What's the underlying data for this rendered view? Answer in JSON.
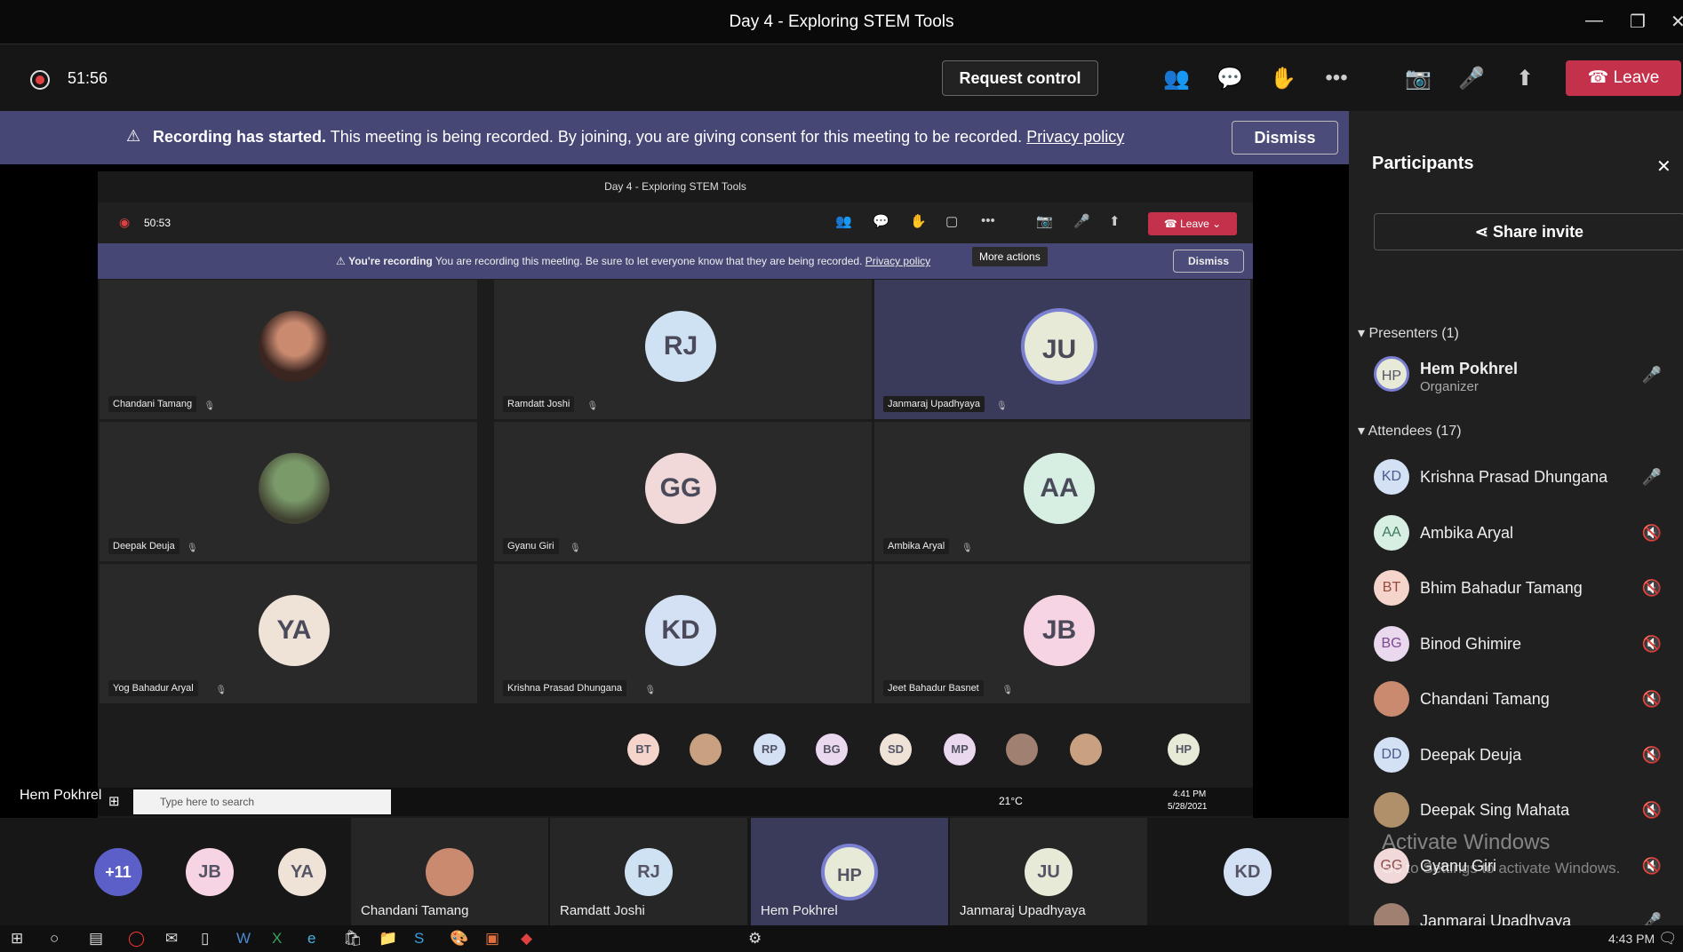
{
  "title": "Day 4 - Exploring STEM Tools",
  "timer": "51:56",
  "toolbar": {
    "request": "Request control",
    "leave": "Leave"
  },
  "banner": {
    "bold": "Recording has started.",
    "text": "This meeting is being recorded. By joining, you are giving consent for this meeting to be recorded.",
    "link": "Privacy policy",
    "dismiss": "Dismiss"
  },
  "inner": {
    "title": "Day 4 - Exploring STEM Tools",
    "timer": "50:53",
    "leave": "Leave",
    "tooltip": "More actions",
    "rec_bold": "You're recording",
    "rec_text": "You are recording this meeting. Be sure to let everyone know that they are being recorded.",
    "link": "Privacy policy",
    "dismiss": "Dismiss"
  },
  "tiles": [
    {
      "name": "Chandani Tamang",
      "initials": "",
      "bg": "#c98a70",
      "photo": true
    },
    {
      "name": "Ramdatt Joshi",
      "initials": "RJ",
      "bg": "#cfe2f3"
    },
    {
      "name": "Janmaraj Upadhyaya",
      "initials": "JU",
      "bg": "#e6ead6"
    },
    {
      "name": "Deepak Deuja",
      "initials": "",
      "bg": "#7a9a6a",
      "photo": true
    },
    {
      "name": "Gyanu Giri",
      "initials": "GG",
      "bg": "#f1d9d9"
    },
    {
      "name": "Ambika Aryal",
      "initials": "AA",
      "bg": "#d7efe2"
    },
    {
      "name": "Yog Bahadur Aryal",
      "initials": "YA",
      "bg": "#efe3d8"
    },
    {
      "name": "Krishna Prasad Dhungana",
      "initials": "KD",
      "bg": "#d4e1f5"
    },
    {
      "name": "Jeet Bahadur Basnet",
      "initials": "JB",
      "bg": "#f7d4e3"
    }
  ],
  "bubbles": [
    "BT",
    "",
    "RP",
    "BG",
    "SD",
    "MP",
    "",
    "",
    "HP"
  ],
  "win_search": "Type here to search",
  "win_weather": "21°C",
  "win_time": "4:41 PM",
  "win_date": "5/28/2021",
  "presenter_label": "Hem Pokhrel",
  "panel": {
    "title": "Participants",
    "share": "Share invite",
    "presenters": "Presenters (1)",
    "attendees": "Attendees (17)",
    "presenter": {
      "initials": "HP",
      "name": "Hem Pokhrel",
      "role": "Organizer"
    },
    "people": [
      {
        "initials": "KD",
        "name": "Krishna Prasad Dhungana",
        "bg": "#d4e1f5",
        "fg": "#4a5a8a"
      },
      {
        "initials": "AA",
        "name": "Ambika Aryal",
        "bg": "#d7efe2",
        "fg": "#3a7a5a"
      },
      {
        "initials": "BT",
        "name": "Bhim Bahadur Tamang",
        "bg": "#f5d4cc",
        "fg": "#9a4a3a"
      },
      {
        "initials": "BG",
        "name": "Binod Ghimire",
        "bg": "#ead8ef",
        "fg": "#7a4a8a"
      },
      {
        "initials": "",
        "name": "Chandani Tamang",
        "bg": "#c98a70",
        "fg": "#fff"
      },
      {
        "initials": "DD",
        "name": "Deepak Deuja",
        "bg": "#d4e1f5",
        "fg": "#4a5a8a"
      },
      {
        "initials": "",
        "name": "Deepak Sing Mahata",
        "bg": "#b0906a",
        "fg": "#fff"
      },
      {
        "initials": "GG",
        "name": "Gyanu Giri",
        "bg": "#f1d9d9",
        "fg": "#8a4a4a"
      },
      {
        "initials": "",
        "name": "Janmaraj Upadhyaya",
        "bg": "#a08070",
        "fg": "#fff"
      }
    ]
  },
  "strip": {
    "more": "+11",
    "items": [
      {
        "initials": "JB",
        "name": ""
      },
      {
        "initials": "YA",
        "name": ""
      },
      {
        "initials": "",
        "name": "Chandani Tamang"
      },
      {
        "initials": "RJ",
        "name": "Ramdatt Joshi"
      },
      {
        "initials": "HP",
        "name": "Hem Pokhrel"
      },
      {
        "initials": "JU",
        "name": "Janmaraj Upadhyaya"
      },
      {
        "initials": "KD",
        "name": ""
      }
    ]
  },
  "watermark": "Activate Windows",
  "watermark2": "Go to Settings to activate Windows.",
  "taskbar_time": "4:43 PM"
}
